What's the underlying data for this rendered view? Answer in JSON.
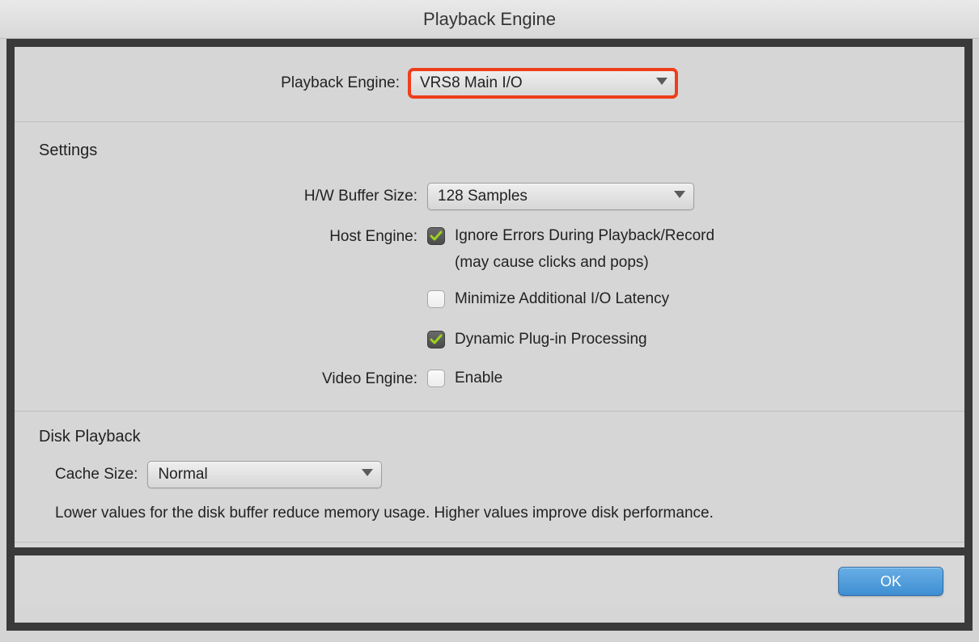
{
  "window": {
    "title": "Playback Engine"
  },
  "top": {
    "playback_engine_label": "Playback Engine:",
    "playback_engine_value": "VRS8 Main I/O"
  },
  "settings": {
    "heading": "Settings",
    "buffer_label": "H/W Buffer Size:",
    "buffer_value": "128 Samples",
    "host_engine_label": "Host Engine:",
    "ignore_errors_label": "Ignore Errors During Playback/Record",
    "ignore_errors_sub": "(may cause clicks and pops)",
    "minimize_latency_label": "Minimize Additional I/O Latency",
    "dynamic_plugin_label": "Dynamic Plug-in Processing",
    "video_engine_label": "Video Engine:",
    "video_enable_label": "Enable",
    "checks": {
      "ignore_errors": true,
      "minimize_latency": false,
      "dynamic_plugin": true,
      "video_enable": false
    }
  },
  "disk": {
    "heading": "Disk Playback",
    "cache_label": "Cache Size:",
    "cache_value": "Normal",
    "note": "Lower values for the disk buffer reduce memory usage.  Higher values improve disk performance."
  },
  "footer": {
    "ok_label": "OK"
  },
  "colors": {
    "highlight": "#ef3e1b",
    "check_fill": "#9bd21e"
  }
}
